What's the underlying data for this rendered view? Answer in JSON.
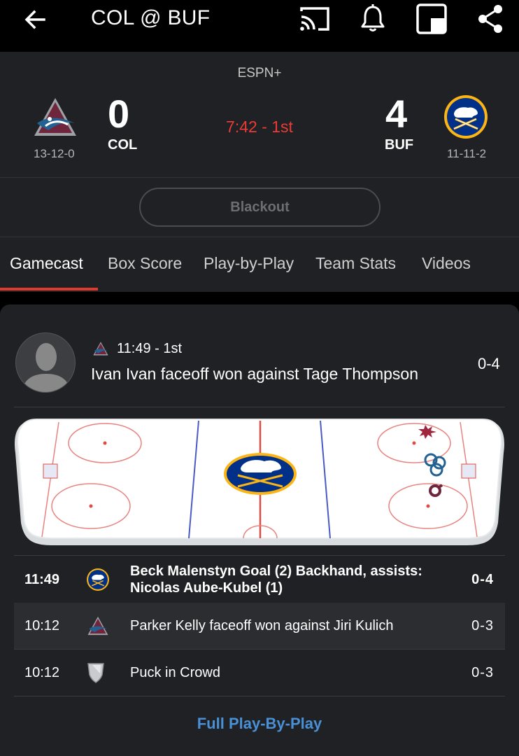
{
  "header": {
    "title": "COL @ BUF",
    "icons": [
      "back-arrow-icon",
      "cast-icon",
      "bell-icon",
      "picture-in-picture-icon",
      "share-icon"
    ]
  },
  "game": {
    "network": "ESPN+",
    "clock": "7:42 - 1st",
    "away": {
      "score": "0",
      "abbr": "COL",
      "record": "13-12-0",
      "color": "#6f263d"
    },
    "home": {
      "score": "4",
      "abbr": "BUF",
      "record": "11-11-2",
      "color": "#003087"
    }
  },
  "blackout": {
    "label": "Blackout"
  },
  "tabs": [
    {
      "label": "Gamecast"
    },
    {
      "label": "Box Score"
    },
    {
      "label": "Play-by-Play"
    },
    {
      "label": "Team Stats"
    },
    {
      "label": "Videos"
    }
  ],
  "featured_play": {
    "time": "11:49 - 1st",
    "text": "Ivan Ivan faceoff won against Tage Thompson",
    "score": "0-4"
  },
  "plays": [
    {
      "time": "11:49",
      "team": "BUF",
      "text": "Beck Malenstyn Goal (2) Backhand, assists: Nicolas Aube-Kubel (1)",
      "score": "0-4"
    },
    {
      "time": "10:12",
      "team": "COL",
      "text": "Parker Kelly faceoff won against Jiri Kulich",
      "score": "0-3"
    },
    {
      "time": "10:12",
      "team": "NHL",
      "text": "Puck in Crowd",
      "score": "0-3"
    }
  ],
  "full_pbp_label": "Full Play-By-Play",
  "colors": {
    "accent_red": "#e03a2f",
    "clock_red": "#ec3b35",
    "link_blue": "#4a90d6"
  }
}
